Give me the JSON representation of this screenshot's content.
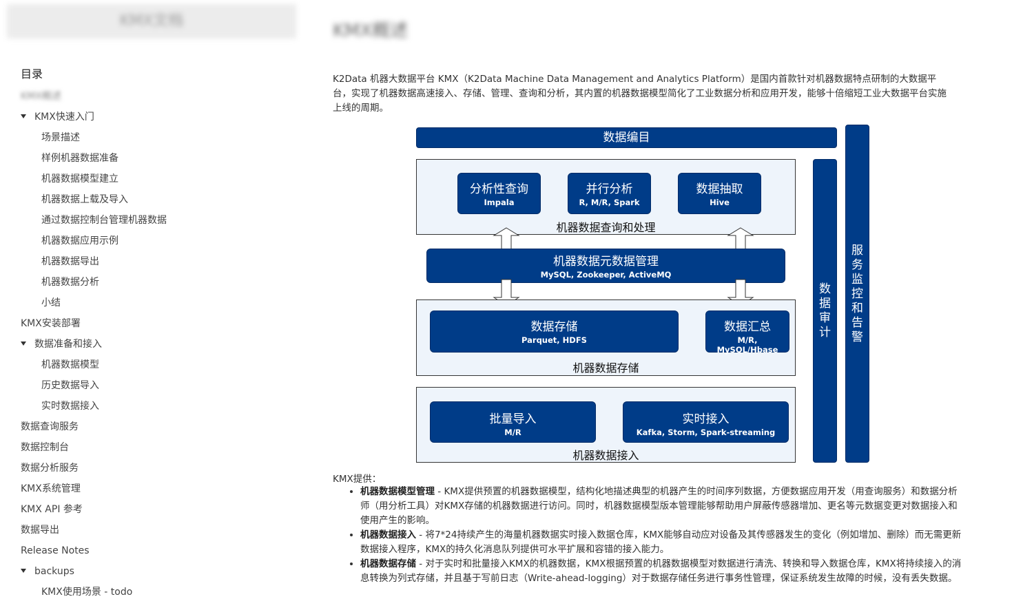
{
  "sidebar": {
    "site_title": "KMX文档",
    "toc_heading": "目录",
    "items": [
      {
        "label": "KMX概述",
        "level": 0,
        "blurred": true
      },
      {
        "label": "KMX快速入门",
        "level": 0,
        "expanded": true
      },
      {
        "label": "场景描述",
        "level": 1
      },
      {
        "label": "样例机器数据准备",
        "level": 1
      },
      {
        "label": "机器数据模型建立",
        "level": 1
      },
      {
        "label": "机器数据上载及导入",
        "level": 1
      },
      {
        "label": "通过数据控制台管理机器数据",
        "level": 1
      },
      {
        "label": "机器数据应用示例",
        "level": 1
      },
      {
        "label": "机器数据导出",
        "level": 1
      },
      {
        "label": "机器数据分析",
        "level": 1
      },
      {
        "label": "小结",
        "level": 1
      },
      {
        "label": "KMX安装部署",
        "level": 0
      },
      {
        "label": "数据准备和接入",
        "level": 0,
        "expanded": true
      },
      {
        "label": "机器数据模型",
        "level": 1
      },
      {
        "label": "历史数据导入",
        "level": 1
      },
      {
        "label": "实时数据接入",
        "level": 1
      },
      {
        "label": "数据查询服务",
        "level": 0
      },
      {
        "label": "数据控制台",
        "level": 0
      },
      {
        "label": "数据分析服务",
        "level": 0
      },
      {
        "label": "KMX系统管理",
        "level": 0
      },
      {
        "label": "KMX API 参考",
        "level": 0
      },
      {
        "label": "数据导出",
        "level": 0
      },
      {
        "label": "Release Notes",
        "level": 0
      },
      {
        "label": "backups",
        "level": 0,
        "expanded": true
      },
      {
        "label": "KMX使用场景 - todo",
        "level": 1
      }
    ]
  },
  "main": {
    "page_title": "KMX概述",
    "intro": "K2Data 机器大数据平台 KMX（K2Data Machine Data Management and Analytics Platform）是国内首款针对机器数据特点研制的大数据平台，实现了机器数据高速接入、存储、管理、查询和分析，其内置的机器数据模型简化了工业数据分析和应用开发，能够十倍缩短工业大数据平台实施上线的周期。",
    "provides_label": "KMX提供：",
    "features": [
      {
        "title": "机器数据模型管理",
        "text": " - KMX提供预置的机器数据模型，结构化地描述典型的机器产生的时间序列数据，方便数据应用开发（用查询服务）和数据分析师（用分析工具）对KMX存储的机器数据进行访问。同时，机器数据模型版本管理能够帮助用户屏蔽传感器增加、更名等元数据变更对数据接入和使用产生的影响。"
      },
      {
        "title": "机器数据接入",
        "text": " - 将7*24持续产生的海量机器数据实时接入数据仓库，KMX能够自动应对设备及其传感器发生的变化（例如增加、删除）而无需更新数据接入程序，KMX的持久化消息队列提供可水平扩展和容错的接入能力。"
      },
      {
        "title": "机器数据存储",
        "text": " - 对于实时和批量接入KMX的机器数据，KMX根据预置的机器数据模型对数据进行清洗、转换和导入数据仓库，KMX将持续接入的消息转换为列式存储，并且基于写前日志（Write-ahead-logging）对于数据存储任务进行事务性管理，保证系统发生故障的时候，没有丢失数据。"
      }
    ]
  },
  "diagram": {
    "catalog": "数据编目",
    "query_panel_label": "机器数据查询和处理",
    "analytic_query": {
      "title": "分析性查询",
      "sub": "Impala"
    },
    "parallel_analysis": {
      "title": "并行分析",
      "sub": "R, M/R, Spark"
    },
    "data_extract": {
      "title": "数据抽取",
      "sub": "Hive"
    },
    "metadata": {
      "title": "机器数据元数据管理",
      "sub": "MySQL, Zookeeper, ActiveMQ"
    },
    "storage_panel_label": "机器数据存储",
    "data_storage": {
      "title": "数据存储",
      "sub": "Parquet, HDFS"
    },
    "data_summary": {
      "title": "数据汇总",
      "sub": "M/R, MySQL/Hbase"
    },
    "ingest_panel_label": "机器数据接入",
    "batch_import": {
      "title": "批量导入",
      "sub": "M/R"
    },
    "realtime_ingest": {
      "title": "实时接入",
      "sub": "Kafka, Storm, Spark-streaming"
    },
    "audit": "数据审计",
    "monitoring": "服务监控和告警"
  },
  "colors": {
    "diagram_blue": "#003c88",
    "panel_bg": "#eef4fb"
  }
}
